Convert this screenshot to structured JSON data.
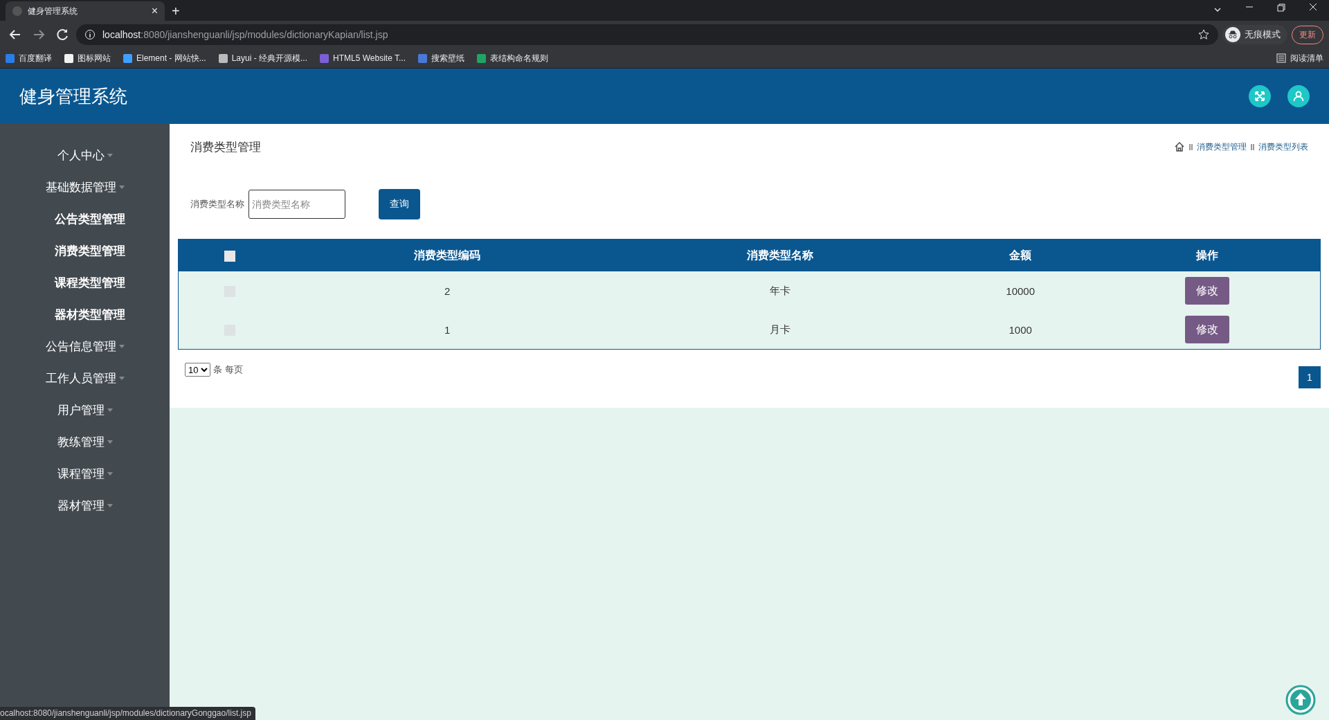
{
  "browser": {
    "tab_title": "健身管理系统",
    "tab_close": "×",
    "new_tab": "+",
    "url_host": "localhost",
    "url_path": ":8080/jianshenguanli/jsp/modules/dictionaryKapian/list.jsp",
    "incognito_label": "无痕模式",
    "update_button": "更新",
    "reading_list": "阅读清单",
    "bookmarks": [
      {
        "label": "百度翻译",
        "color": "#2b7de9"
      },
      {
        "label": "图标网站",
        "color": "#f2f2f2"
      },
      {
        "label": "Element - 网站快...",
        "color": "#409eff"
      },
      {
        "label": "Layui - 经典开源模...",
        "color": "#bbbbbb"
      },
      {
        "label": "HTML5 Website T...",
        "color": "#7b5fd6"
      },
      {
        "label": "搜索壁纸",
        "color": "#4a78d8"
      },
      {
        "label": "表结构命名规则",
        "color": "#1fa463"
      }
    ]
  },
  "header": {
    "title": "健身管理系统"
  },
  "sidebar": {
    "items": [
      {
        "label": "个人中心"
      },
      {
        "label": "基础数据管理",
        "children": [
          {
            "label": "公告类型管理"
          },
          {
            "label": "消费类型管理"
          },
          {
            "label": "课程类型管理"
          },
          {
            "label": "器材类型管理"
          }
        ]
      },
      {
        "label": "公告信息管理"
      },
      {
        "label": "工作人员管理"
      },
      {
        "label": "用户管理"
      },
      {
        "label": "教练管理"
      },
      {
        "label": "课程管理"
      },
      {
        "label": "器材管理"
      }
    ]
  },
  "page": {
    "title": "消费类型管理",
    "breadcrumb": [
      "消费类型管理",
      "消费类型列表"
    ]
  },
  "search": {
    "label": "消费类型名称",
    "placeholder": "消费类型名称",
    "button": "查询"
  },
  "table": {
    "select_all_checked": false,
    "columns": [
      "消费类型编码",
      "消费类型名称",
      "金额",
      "操作"
    ],
    "rows": [
      {
        "checked": false,
        "code": "2",
        "name": "年卡",
        "amount": "10000",
        "action": "修改"
      },
      {
        "checked": false,
        "code": "1",
        "name": "月卡",
        "amount": "1000",
        "action": "修改"
      }
    ]
  },
  "pagination": {
    "page_size": "10",
    "page_size_suffix": "条 每页",
    "pages": [
      {
        "label": "1",
        "selected": true
      }
    ]
  },
  "status_bar": {
    "url": "ocalhost:8080/jianshenguanli/jsp/modules/dictionaryGonggao/list.jsp"
  }
}
